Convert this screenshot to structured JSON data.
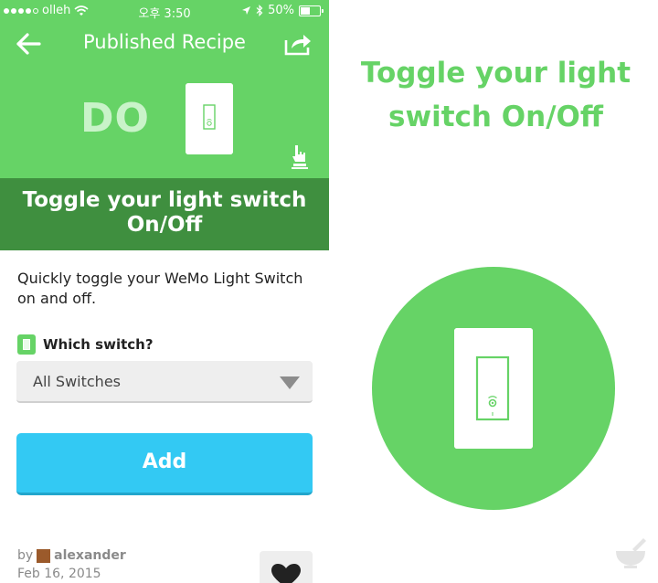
{
  "status_bar": {
    "carrier": "olleh",
    "time": "오후 3:50",
    "battery": "50%",
    "battery_level": 0.5
  },
  "header": {
    "title": "Published Recipe",
    "back_icon": "back-arrow-icon",
    "share_icon": "share-icon",
    "action_text": "DO",
    "channel_icon": "hand-pointer-icon"
  },
  "recipe": {
    "title": "Toggle your light switch On/Off",
    "description": "Quickly toggle your WeMo Light Switch on and off."
  },
  "field": {
    "label": "Which switch?",
    "selected": "All Switches"
  },
  "add_button": {
    "label": "Add"
  },
  "author": {
    "by": "by",
    "name": "alexander",
    "date": "Feb 16, 2015"
  },
  "preview": {
    "title_line1": "Toggle your light",
    "title_line2": "switch On/Off"
  },
  "colors": {
    "brand_green": "#66d366",
    "dark_green": "#3f8f3f",
    "add_blue": "#33c9f3",
    "switch_outline": "#66d366"
  }
}
